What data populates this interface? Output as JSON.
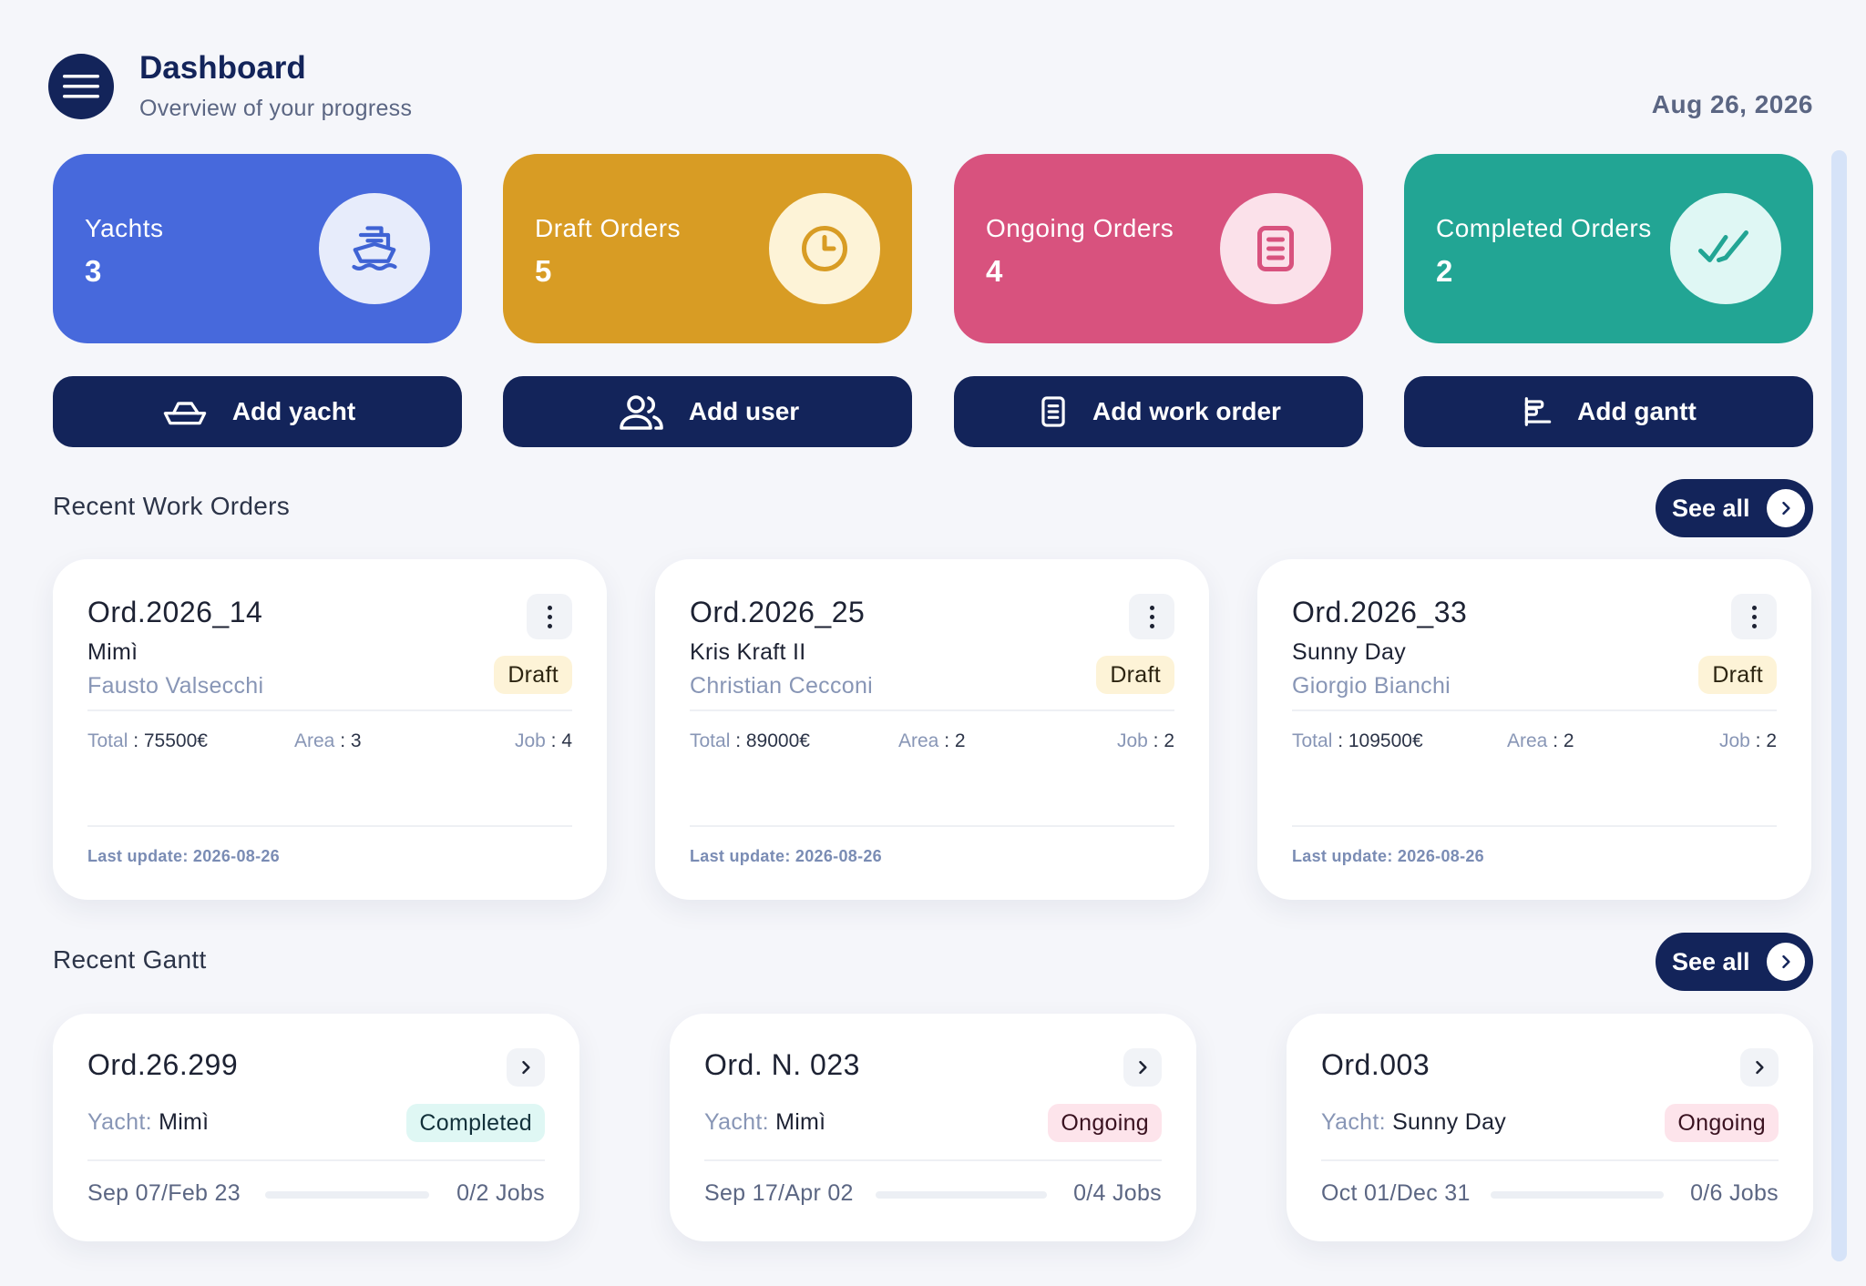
{
  "header": {
    "title": "Dashboard",
    "subtitle": "Overview of your progress",
    "date": "Aug 26, 2026"
  },
  "stats": [
    {
      "label": "Yachts",
      "value": "3",
      "icon": "ship-icon",
      "color": "#4769dc",
      "icon_bg": "#e7ecfb",
      "icon_color": "#3f63d4"
    },
    {
      "label": "Draft Orders",
      "value": "5",
      "icon": "clock-icon",
      "color": "#d89c24",
      "icon_bg": "#fdf3d7",
      "icon_color": "#d89c24"
    },
    {
      "label": "Ongoing Orders",
      "value": "4",
      "icon": "document-icon",
      "color": "#d8527e",
      "icon_bg": "#fbe1ea",
      "icon_color": "#d8527e"
    },
    {
      "label": "Completed Orders",
      "value": "2",
      "icon": "double-check-icon",
      "color": "#22a594",
      "icon_bg": "#dff7f4",
      "icon_color": "#22a594"
    }
  ],
  "actions": [
    {
      "label": "Add yacht",
      "icon": "boat-outline-icon"
    },
    {
      "label": "Add user",
      "icon": "users-icon"
    },
    {
      "label": "Add work order",
      "icon": "document-icon"
    },
    {
      "label": "Add gantt",
      "icon": "gantt-icon"
    }
  ],
  "work_orders_section": {
    "title": "Recent Work Orders",
    "see_all": "See all"
  },
  "work_orders": [
    {
      "code": "Ord.2026_14",
      "yacht": "Mimì",
      "owner": "Fausto Valsecchi",
      "status": "Draft",
      "total_label": "Total",
      "total": "75500€",
      "area_label": "Area",
      "area": "3",
      "job_label": "Job",
      "job": "4",
      "last_update": "Last update: 2026-08-26"
    },
    {
      "code": "Ord.2026_25",
      "yacht": "Kris Kraft II",
      "owner": "Christian Cecconi",
      "status": "Draft",
      "total_label": "Total",
      "total": "89000€",
      "area_label": "Area",
      "area": "2",
      "job_label": "Job",
      "job": "2",
      "last_update": "Last update: 2026-08-26"
    },
    {
      "code": "Ord.2026_33",
      "yacht": "Sunny Day",
      "owner": "Giorgio Bianchi",
      "status": "Draft",
      "total_label": "Total",
      "total": "109500€",
      "area_label": "Area",
      "area": "2",
      "job_label": "Job",
      "job": "2",
      "last_update": "Last update: 2026-08-26"
    }
  ],
  "gantt_section": {
    "title": "Recent Gantt",
    "see_all": "See all"
  },
  "gantts": [
    {
      "code": "Ord.26.299",
      "yacht_label": "Yacht:",
      "yacht": "Mimì",
      "status": "Completed",
      "status_type": "completed",
      "dates": "Sep 07/Feb 23",
      "jobs": "0/2 Jobs",
      "progress": 0
    },
    {
      "code": "Ord. N. 023",
      "yacht_label": "Yacht:",
      "yacht": "Mimì",
      "status": "Ongoing",
      "status_type": "ongoing",
      "dates": "Sep 17/Apr 02",
      "jobs": "0/4 Jobs",
      "progress": 0
    },
    {
      "code": "Ord.003",
      "yacht_label": "Yacht:",
      "yacht": "Sunny Day",
      "status": "Ongoing",
      "status_type": "ongoing",
      "dates": "Oct 01/Dec 31",
      "jobs": "0/6 Jobs",
      "progress": 0
    }
  ]
}
